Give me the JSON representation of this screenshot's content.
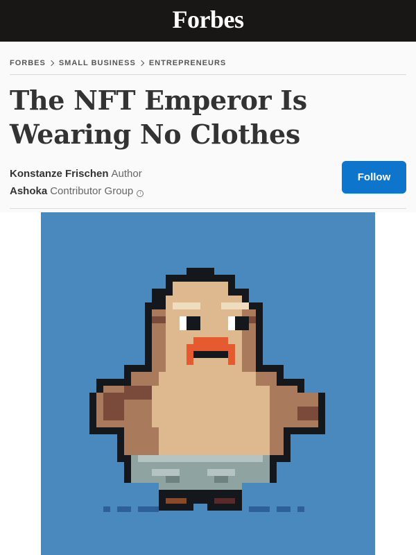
{
  "brand": {
    "logo_text": "Forbes"
  },
  "breadcrumb": [
    "FORBES",
    "SMALL BUSINESS",
    "ENTREPRENEURS"
  ],
  "article": {
    "headline_line1": "The NFT Emperor Is",
    "headline_line2": "Wearing No Clothes"
  },
  "authors": [
    {
      "name": "Konstanze Frischen",
      "role": "Author"
    },
    {
      "name": "Ashoka",
      "role": "Contributor Group"
    }
  ],
  "follow_label": "Follow",
  "hero_image": {
    "icon": "pixel-art-emperor-character"
  },
  "colors": {
    "topbar": "#181716",
    "accent": "#0e75cc",
    "hero_bg": "#4a89bd"
  }
}
